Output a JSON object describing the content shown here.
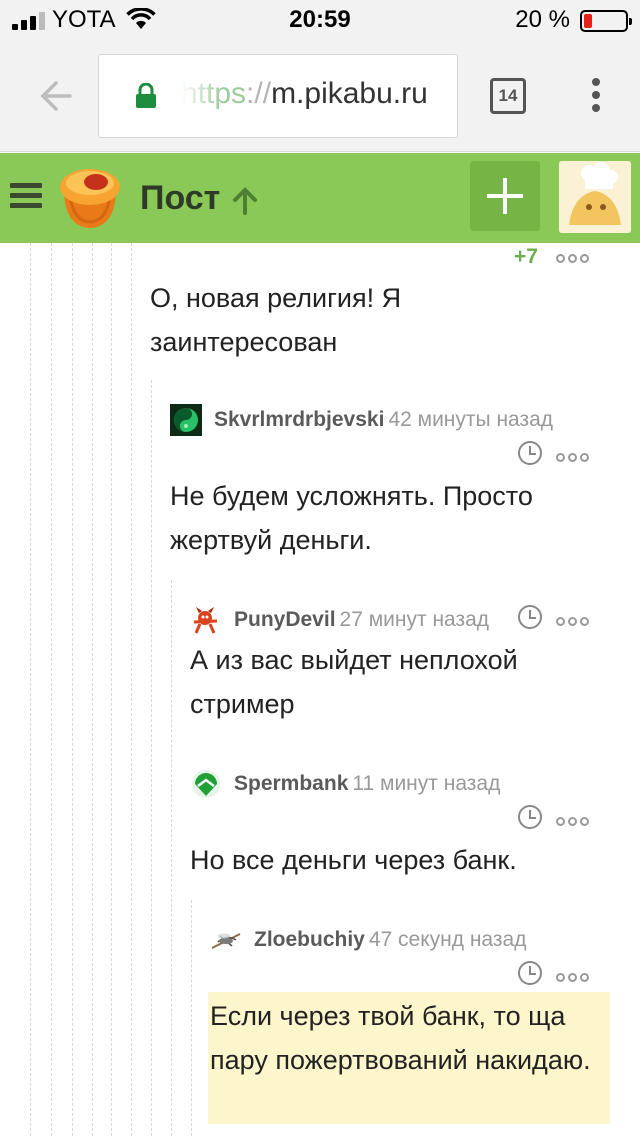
{
  "status_bar": {
    "carrier": "YOTA",
    "time": "20:59",
    "battery_percent": "20 %",
    "battery_level": 0.2
  },
  "browser": {
    "url_scheme": "https",
    "url_sep": "://",
    "url_host": "m.pikabu.ru",
    "tab_count": "14"
  },
  "header": {
    "title": "Пост"
  },
  "thread": {
    "parent": {
      "score": "+7",
      "text": "О, новая религия! Я заинтересован"
    },
    "comments": [
      {
        "user": "Skvrlmrdrbjevski",
        "time": "42 минуты назад",
        "text": "Не будем усложнять. Просто жертвуй деньги."
      },
      {
        "user": "PunyDevil",
        "time": "27 минут назад",
        "text": "А из вас выйдет неплохой стример"
      },
      {
        "user": "Spermbank",
        "time": "11 минут назад",
        "text": "Но все деньги через банк."
      },
      {
        "user": "Zloebuchiy",
        "time": "47 секунд назад",
        "text": "Если через твой банк, то ща пару пожертвований накидаю."
      }
    ]
  },
  "colors": {
    "header_green": "#8ac858",
    "score_green": "#6ab04c",
    "highlight": "#fdf6cc"
  }
}
